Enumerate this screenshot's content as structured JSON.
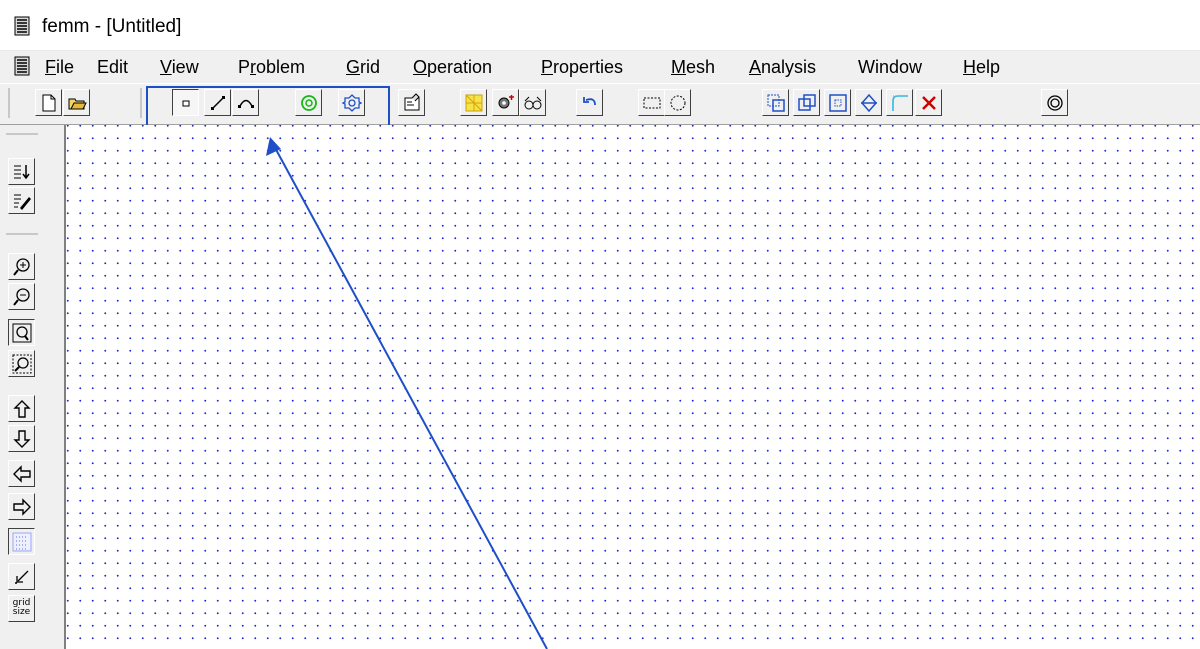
{
  "window": {
    "title": "femm - [Untitled]"
  },
  "menu": {
    "items": [
      {
        "label_acc": "F",
        "label_rest": "ile"
      },
      {
        "label_acc": "",
        "label_rest": "Edit"
      },
      {
        "label_acc": "V",
        "label_rest": "iew"
      },
      {
        "label_pre": "P",
        "label_acc": "r",
        "label_rest": "oblem"
      },
      {
        "label_acc": "G",
        "label_rest": "rid"
      },
      {
        "label_acc": "O",
        "label_rest": "peration"
      },
      {
        "label_acc": "P",
        "label_rest": "roperties"
      },
      {
        "label_acc": "M",
        "label_rest": "esh"
      },
      {
        "label_acc": "A",
        "label_rest": "nalysis"
      },
      {
        "label_acc": "",
        "label_rest": "Window"
      },
      {
        "label_acc": "H",
        "label_rest": "elp"
      }
    ]
  },
  "left_toolbar": {
    "grid_size_label_1": "grid",
    "grid_size_label_2": "size"
  },
  "colors": {
    "highlight": "#1f4fc7",
    "grid_dots": "#1a2ad6",
    "toolbar_bg": "#f0f0f0"
  }
}
